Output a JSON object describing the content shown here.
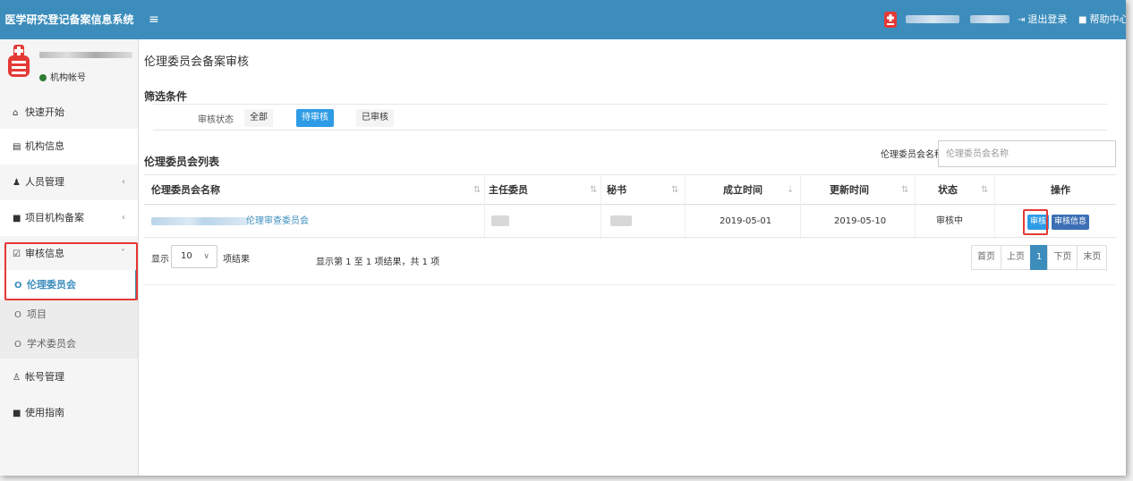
{
  "header": {
    "app_title": "医学研究登记备案信息系统",
    "menu_icon": "≡",
    "logout_label": "退出登录",
    "help_label": "帮助中心"
  },
  "sidebar": {
    "user_status": "机构帐号",
    "items": [
      {
        "label": "快速开始",
        "icon": "home-icon",
        "glyph": "🏠"
      },
      {
        "label": "机构信息",
        "icon": "building-icon",
        "glyph": "🏢"
      },
      {
        "label": "人员管理",
        "icon": "users-icon",
        "glyph": "👥"
      },
      {
        "label": "项目机构备案",
        "icon": "book-icon",
        "glyph": "📘"
      },
      {
        "label": "审核信息",
        "icon": "checkbox-icon",
        "glyph": "☑"
      },
      {
        "label": "伦理委员会",
        "icon": "circle-icon",
        "glyph": "O"
      },
      {
        "label": "项目",
        "icon": "circle-icon",
        "glyph": "O"
      },
      {
        "label": "学术委员会",
        "icon": "circle-icon",
        "glyph": "O"
      },
      {
        "label": "帐号管理",
        "icon": "user-icon",
        "glyph": "👤"
      },
      {
        "label": "使用指南",
        "icon": "book-icon",
        "glyph": "📖"
      }
    ]
  },
  "main": {
    "page_title": "伦理委员会备案审核",
    "filter": {
      "title": "筛选条件",
      "status_label": "审核状态",
      "options": [
        "全部",
        "待审核",
        "已审核"
      ],
      "selected": "待审核"
    },
    "list": {
      "title": "伦理委员会列表",
      "search_label": "伦理委员会名称",
      "search_placeholder": "伦理委员会名称",
      "columns": [
        "伦理委员会名称",
        "主任委员",
        "秘书",
        "成立时间",
        "更新时间",
        "状态",
        "操作"
      ],
      "rows": [
        {
          "name_suffix": "伦理审查委员会",
          "established": "2019-05-01",
          "updated": "2019-05-10",
          "status": "审核中",
          "actions": [
            "审核",
            "审核信息"
          ]
        }
      ]
    },
    "pager": {
      "show_label": "显示",
      "page_size": "10",
      "unit_label": "项结果",
      "info": "显示第 1 至 1 项结果，共 1 项",
      "buttons": [
        "首页",
        "上页",
        "1",
        "下页",
        "末页"
      ],
      "current": "1"
    }
  },
  "colors": {
    "header_bg": "#3c8dbc",
    "active_blue": "#2e9be6",
    "highlight_red": "#e53935"
  }
}
